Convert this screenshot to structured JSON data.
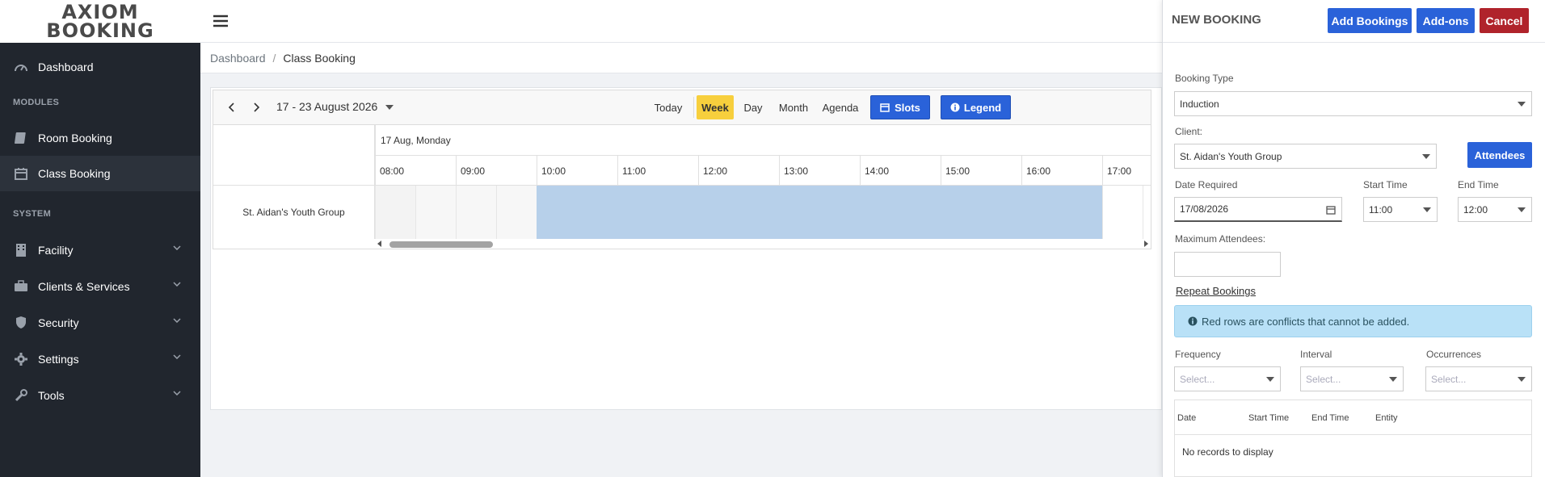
{
  "logo": {
    "line1": "AXIOM",
    "line2": "BOOKING"
  },
  "sidebar": {
    "items_top": [
      {
        "label": "Dashboard",
        "icon": "dashboard-icon"
      }
    ],
    "modules_heading": "MODULES",
    "modules": [
      {
        "label": "Room Booking",
        "icon": "book-icon"
      },
      {
        "label": "Class Booking",
        "icon": "calendar-icon"
      }
    ],
    "system_heading": "SYSTEM",
    "system": [
      {
        "label": "Facility",
        "icon": "building-icon"
      },
      {
        "label": "Clients & Services",
        "icon": "briefcase-icon"
      },
      {
        "label": "Security",
        "icon": "shield-icon"
      },
      {
        "label": "Settings",
        "icon": "gear-icon"
      },
      {
        "label": "Tools",
        "icon": "wrench-icon"
      }
    ]
  },
  "breadcrumb": {
    "parent": "Dashboard",
    "separator": "/",
    "current": "Class Booking"
  },
  "scheduler": {
    "date_range": "17 - 23 August 2026",
    "views": {
      "today": "Today",
      "week": "Week",
      "day": "Day",
      "month": "Month",
      "agenda": "Agenda"
    },
    "slots_label": "Slots",
    "legend_label": "Legend",
    "day_header": "17 Aug, Monday",
    "times": [
      "08:00",
      "09:00",
      "10:00",
      "11:00",
      "12:00",
      "13:00",
      "14:00",
      "15:00",
      "16:00",
      "17:00"
    ],
    "resource": "St. Aidan's Youth Group",
    "booked_from": "10:00",
    "booked_to": "17:00"
  },
  "panel": {
    "title": "NEW BOOKING",
    "add_bookings": "Add Bookings",
    "addons": "Add-ons",
    "cancel": "Cancel",
    "booking_type_label": "Booking Type",
    "booking_type": "Induction",
    "client_label": "Client:",
    "client": "St. Aidan's Youth Group",
    "attendees": "Attendees",
    "date_label": "Date Required",
    "date": "17/08/2026",
    "start_label": "Start Time",
    "start": "11:00",
    "end_label": "End Time",
    "end": "12:00",
    "max_label": "Maximum Attendees:",
    "repeat_label": "Repeat Bookings",
    "info": "Red rows are conflicts that cannot be added.",
    "frequency_label": "Frequency",
    "interval_label": "Interval",
    "occurrences_label": "Occurrences",
    "select_placeholder": "Select...",
    "table_headers": [
      "Date",
      "Start Time",
      "End Time",
      "Entity"
    ],
    "no_records": "No records to display"
  },
  "colors": {
    "sidebar": "#21262e",
    "accent_blue": "#2a62d9",
    "cancel_red": "#b0232b",
    "week_yellow": "#f7cf3d",
    "booked": "#b7d0ea"
  }
}
